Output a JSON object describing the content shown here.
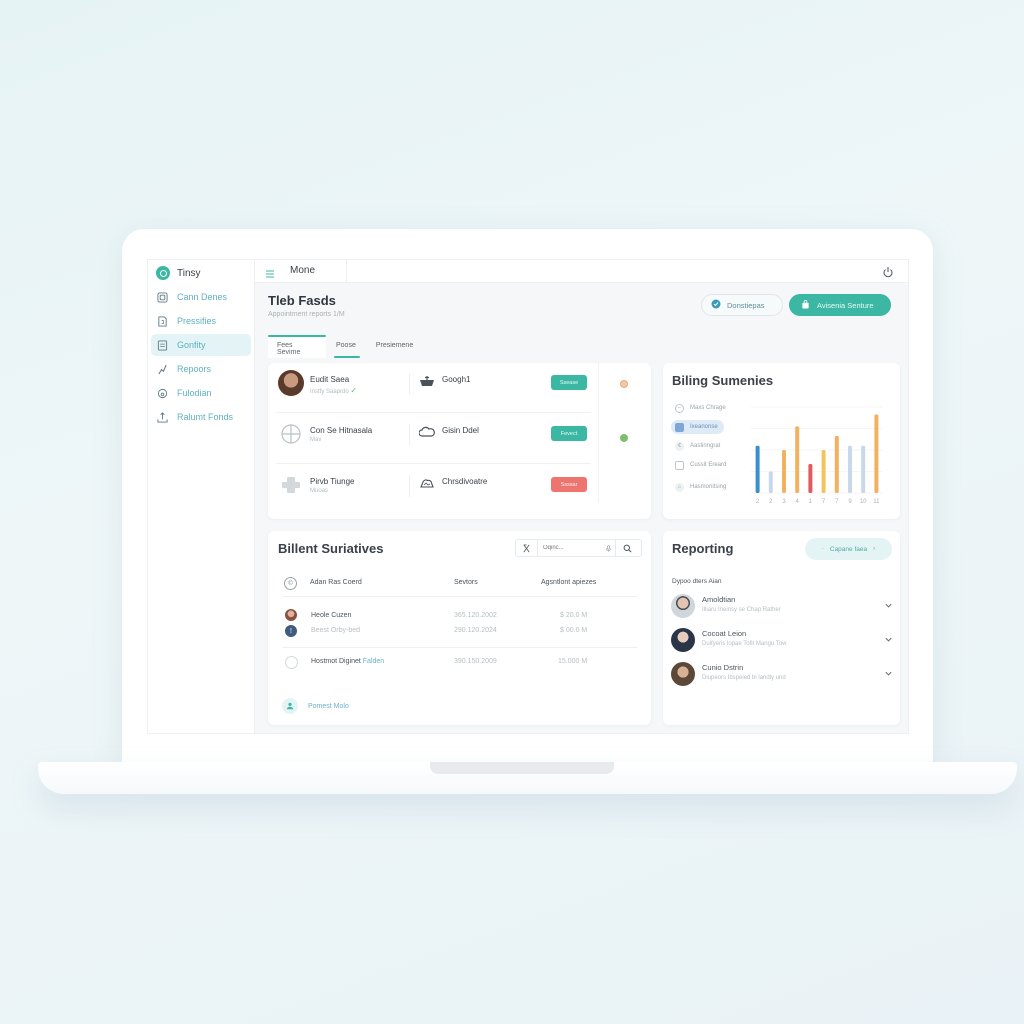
{
  "app": {
    "name": "Tinsy",
    "section": "Mone"
  },
  "sidebar": {
    "items": [
      {
        "label": "Cann Denes",
        "icon": "dashboard-icon"
      },
      {
        "label": "Pressifies",
        "icon": "file-icon"
      },
      {
        "label": "Gonfity",
        "icon": "list-icon",
        "active": true
      },
      {
        "label": "Repoors",
        "icon": "chart-icon"
      },
      {
        "label": "Fulodian",
        "icon": "location-icon"
      },
      {
        "label": "Ralumt Fonds",
        "icon": "upload-icon"
      }
    ]
  },
  "header": {
    "title": "Tleb Fasds",
    "subtitle": "Appointment reports 1/M",
    "outline_button": "Donstiepas",
    "primary_button": "Avisenia Senture",
    "tabs": [
      "Fees Sevime",
      "Poose",
      "Presiemene"
    ]
  },
  "people": {
    "rows": [
      {
        "name": "Eudit Saea",
        "sub": "Instfy Saaprdo",
        "verified": true,
        "service": "Googh1",
        "service_icon": "basket-icon",
        "status": "Ssease",
        "status_color": "#3bb7a3",
        "dot_color": "#f0b48a"
      },
      {
        "name": "Con Se Hitnasala",
        "sub": "Mav",
        "verified": false,
        "service": "Gisin Ddel",
        "service_icon": "cloud-icon",
        "status": "Fevect",
        "status_color": "#3bb7a3",
        "dot_color": "#7cc06e"
      },
      {
        "name": "Pirvb Tiunge",
        "sub": "Muoas",
        "verified": false,
        "service": "Chrsdivoatre",
        "service_icon": "cloud-outline-icon",
        "status": "Ssssar",
        "status_color": "#ee7470",
        "dot_color": null
      }
    ]
  },
  "billing": {
    "title": "Biling Sumenies",
    "legend": [
      {
        "label": "Maxs Chrage",
        "icon": "minus-circle-icon"
      },
      {
        "label": "Ixeanonse",
        "icon": "square-icon",
        "active": true
      },
      {
        "label": "Aastinngrat",
        "icon": "euro-icon"
      },
      {
        "label": "Cussit Ereard",
        "icon": "calendar-icon"
      },
      {
        "label": "Hasmonitsing",
        "icon": "home-icon"
      }
    ]
  },
  "chart_data": {
    "type": "bar",
    "title": "Biling Sumenies",
    "categories": [
      "2",
      "2",
      "3",
      "4",
      "1",
      "7",
      "7",
      "9",
      "10",
      "11"
    ],
    "values": [
      44,
      20,
      40,
      62,
      27,
      40,
      53,
      44,
      44,
      73
    ],
    "colors": [
      "#3a8fcf",
      "#c7d8ec",
      "#f1b15e",
      "#f1b15e",
      "#e4595f",
      "#f3c45d",
      "#f1b15e",
      "#c7d8ec",
      "#c7d8ec",
      "#f1b15e"
    ],
    "xlabel": "",
    "ylabel": "",
    "ylim": [
      0,
      80
    ],
    "grid": true
  },
  "services": {
    "title": "Billent Suriatives",
    "search_placeholder": "Oqinc...",
    "columns": [
      "Adan Ras Coerd",
      "Sevtors",
      "Agsntlont apiezes"
    ],
    "rows": [
      {
        "name": "Heole Cuzen",
        "date": "365.120.2002",
        "amount": "$ 20.0 M"
      },
      {
        "name": "Beest Orby-bed",
        "date": "290.120.2024",
        "amount": "$ 00.0 M",
        "muted": true
      },
      {
        "name": "Hostmot Diginet",
        "tag": "Falden",
        "date": "390.150.2009",
        "amount": "15.000 M"
      }
    ],
    "footer_link": "Pomest Molo"
  },
  "reporting": {
    "title": "Reporting",
    "button": "Capane faea",
    "label": "Dypoo dters Aian",
    "items": [
      {
        "name": "Amoldtian",
        "desc": "Illiaru Ineinsy se Chap Rather",
        "avatar_color": "#9aa9b4"
      },
      {
        "name": "Cocoat Leion",
        "desc": "Duifyeris lopae Tofit Mangu Tow",
        "avatar_color": "#2f3a4c"
      },
      {
        "name": "Cunio Dstrin",
        "desc": "Diupeors Ibspeied bi landly und",
        "avatar_color": "#6b5a48"
      }
    ]
  }
}
